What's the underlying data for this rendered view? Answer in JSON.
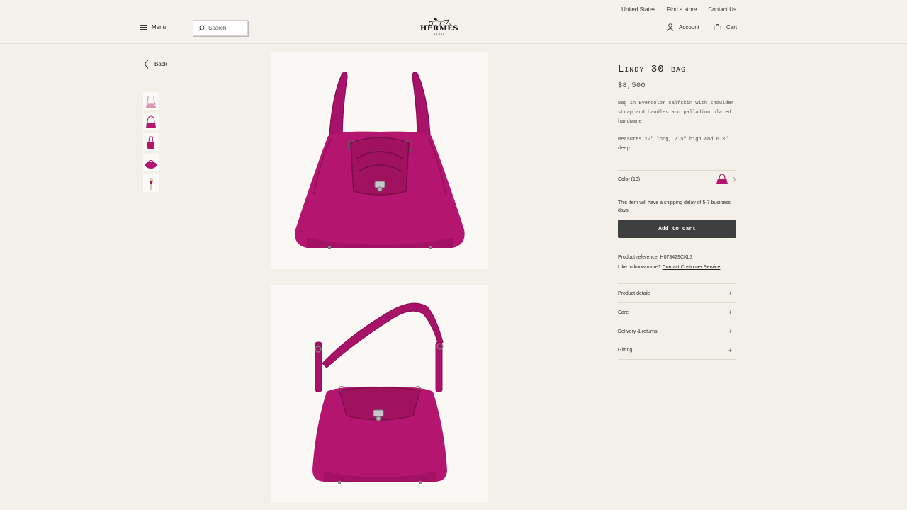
{
  "header": {
    "util_links": [
      "United States",
      "Find a store",
      "Contact Us"
    ],
    "menu_label": "Menu",
    "search_placeholder": "Search",
    "logo_name": "HERMÈS",
    "logo_city": "PARIS",
    "account_label": "Account",
    "cart_label": "Cart"
  },
  "nav": {
    "back_label": "Back"
  },
  "product": {
    "title": "Lindy 30 bag",
    "price": "$8,500",
    "description": "Bag in Evercolor calfskin with shoulder strap and handles and palladium plated hardware",
    "measures": "Measures 12\" long, 7.5\" high and 6.3\" deep",
    "color_label": "Color (10)",
    "shipping_note": "This item will have a shipping delay of 5-7 business days.",
    "add_to_cart": "Add to cart",
    "reference": "Product reference: H073429CKL3",
    "know_more": "Like to know more?",
    "contact_link": "Contact Customer Service",
    "accordion": [
      "Product details",
      "Care",
      "Delivery & returns",
      "Gifting"
    ]
  },
  "colors": {
    "bag": "#b4156e",
    "bag_dark": "#8e0f56",
    "background": "#f3efe9",
    "button": "#3f3f3f"
  },
  "icons": [
    "menu-icon",
    "search-icon",
    "hermes-logo",
    "account-icon",
    "cart-icon",
    "back-chevron-icon",
    "chevron-right-icon",
    "plus-icon"
  ]
}
